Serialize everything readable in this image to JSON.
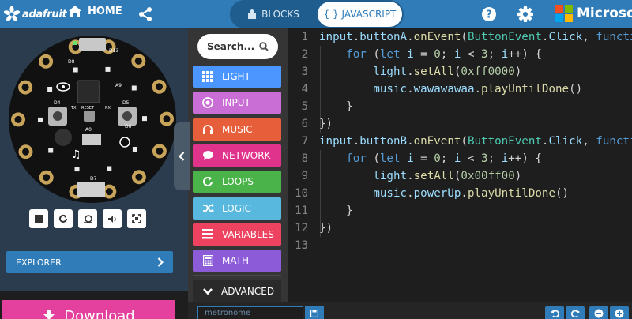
{
  "header": {
    "brand": "adafruit",
    "home_label": "HOME",
    "blocks_label": "BLOCKS",
    "javascript_label": "JAVASCRIPT",
    "ms_brand": "Microsoft"
  },
  "board_labels": {
    "top": [
      "D13",
      "D8",
      "D7",
      "A9"
    ],
    "leds": [
      "D4",
      "D5",
      "RX",
      "TX",
      "RESET",
      "A0",
      "D6"
    ]
  },
  "simulator": {
    "explorer_label": "EXPLORER",
    "download_label": "Download"
  },
  "toolbox": {
    "search_placeholder": "Search...",
    "categories": [
      {
        "label": "LIGHT",
        "color": "#4c97ff",
        "icon": "grid-icon"
      },
      {
        "label": "INPUT",
        "color": "#c96ed4",
        "icon": "radio-icon"
      },
      {
        "label": "MUSIC",
        "color": "#e65f3a",
        "icon": "headphones-icon"
      },
      {
        "label": "NETWORK",
        "color": "#e0338c",
        "icon": "chat-icon"
      },
      {
        "label": "LOOPS",
        "color": "#4ab34a",
        "icon": "refresh-icon"
      },
      {
        "label": "LOGIC",
        "color": "#58b8dd",
        "icon": "shuffle-icon"
      },
      {
        "label": "VARIABLES",
        "color": "#ee4360",
        "icon": "list-icon"
      },
      {
        "label": "MATH",
        "color": "#8c5cd8",
        "icon": "calculator-icon"
      }
    ],
    "advanced_label": "ADVANCED"
  },
  "editor": {
    "line_numbers": [
      "1",
      "2",
      "3",
      "4",
      "5",
      "6",
      "7",
      "8",
      "9",
      "10",
      "11",
      "12",
      "13"
    ]
  },
  "bottombar": {
    "project_name": "metronome"
  },
  "colors": {
    "topbar": "#2f7cb9",
    "download": "#e4409d",
    "editor_bg": "#1e1e1e"
  }
}
